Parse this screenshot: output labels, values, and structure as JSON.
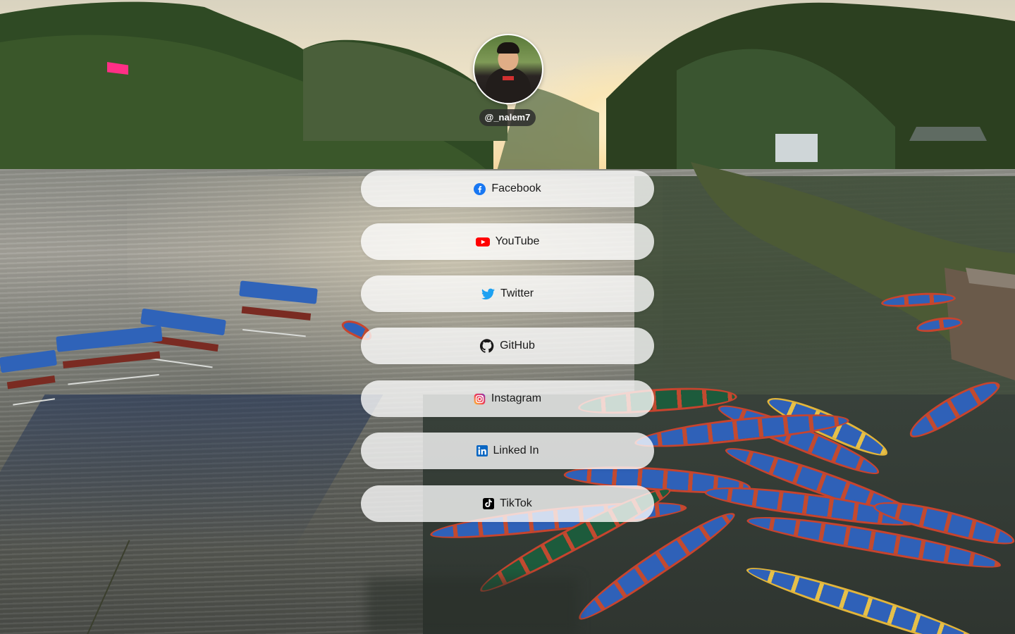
{
  "profile": {
    "username": "@_nalem7"
  },
  "links": [
    {
      "label": "Facebook",
      "icon": "facebook-icon",
      "color": "#1877f2"
    },
    {
      "label": "YouTube",
      "icon": "youtube-icon",
      "color": "#ff0000"
    },
    {
      "label": "Twitter",
      "icon": "twitter-icon",
      "color": "#1da1f2"
    },
    {
      "label": "GitHub",
      "icon": "github-icon",
      "color": "#181717"
    },
    {
      "label": "Instagram",
      "icon": "instagram-icon",
      "color": "#e1306c"
    },
    {
      "label": "Linked In",
      "icon": "linkedin-icon",
      "color": "#0a66c2"
    },
    {
      "label": "TikTok",
      "icon": "tiktok-icon",
      "color": "#000000"
    }
  ],
  "theme": {
    "button_background": "#ffffff",
    "username_badge": "#2d2d2d"
  }
}
